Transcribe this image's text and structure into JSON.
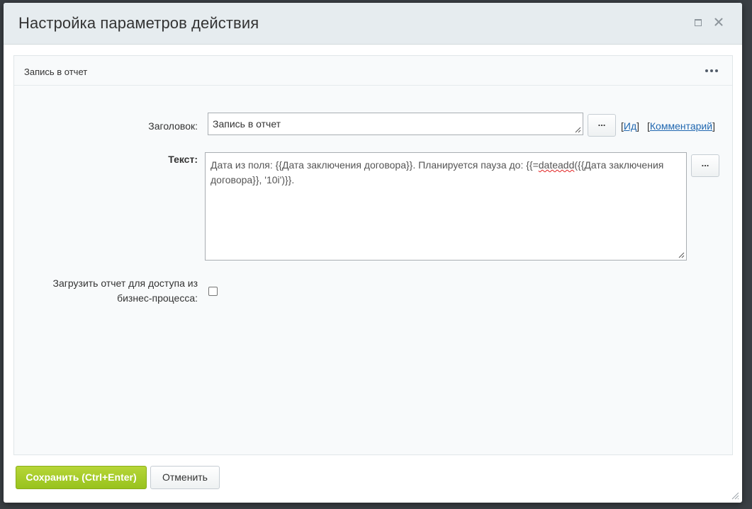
{
  "dialog": {
    "title": "Настройка параметров действия"
  },
  "panel": {
    "title": "Запись в отчет"
  },
  "form": {
    "heading_label": "Заголовок:",
    "heading_value": "Запись в отчет",
    "text_label": "Текст:",
    "text_value_part1": "Дата из поля: {{Дата заключения договора}}. Планируется пауза до: {{=",
    "text_value_spell": "dateadd",
    "text_value_part2": "({{Дата заключения договора}}, '10i')}}.",
    "upload_label_line1": "Загрузить отчет для доступа из",
    "upload_label_line2": "бизнес-процесса:",
    "ellipsis_label": "...",
    "id_link": "Ид",
    "comment_link": "Комментарий"
  },
  "footer": {
    "save_label": "Сохранить (Ctrl+Enter)",
    "cancel_label": "Отменить"
  },
  "icons": {
    "maximize": "maximize-icon",
    "close": "close-icon",
    "more": "more-dots-icon",
    "resize": "resize-grip-icon"
  },
  "colors": {
    "accent_green": "#9dc626",
    "link_blue": "#2067b0",
    "titlebar": "#e6ecef"
  }
}
